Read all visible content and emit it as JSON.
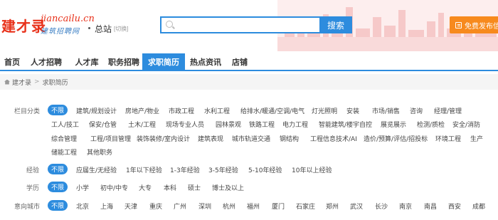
{
  "logo": {
    "main": "建才录",
    "domain": "jiancailu.cn",
    "sub": "建筑招聘网"
  },
  "site": {
    "name": "总站",
    "switch": "[切换]"
  },
  "search": {
    "placeholder": "",
    "button": "搜索"
  },
  "post_button": "免费发布信",
  "nav": [
    "首页",
    "人才招聘",
    "人才库",
    "职务招聘",
    "求职简历",
    "热点资讯",
    "店铺"
  ],
  "breadcrumb": {
    "home": "建才录",
    "current": "求职简历"
  },
  "filters": {
    "category": {
      "label": "栏目分类",
      "items": [
        "不限",
        "建筑/规划设计",
        "房地产/物业",
        "市政工程",
        "水利工程",
        "给排水/暖通/空调/电气",
        "灯光照明",
        "安装",
        "市场/销售",
        "咨询",
        "经理/管理",
        "工人/技工",
        "保安/仓管",
        "土木/工程",
        "现场专业人员",
        "园林景观",
        "铁路工程",
        "电力工程",
        "智能建筑/楼宇自控",
        "展览展示",
        "检测/质检",
        "安全/消防",
        "综合管理",
        "工程/项目管理",
        "装饰装修/室内设计",
        "建筑表现",
        "城市轨道交通",
        "钢结构",
        "工程信息技术/AI",
        "造价/预算/评估/招投标",
        "环境工程",
        "生产",
        "储能工程",
        "其他职务"
      ]
    },
    "experience": {
      "label": "经验",
      "items": [
        "不限",
        "应届生/无经验",
        "1年以下经验",
        "1-3年经验",
        "3-5年经验",
        "5-10年经验",
        "10年以上经验"
      ]
    },
    "education": {
      "label": "学历",
      "items": [
        "不限",
        "小学",
        "初中/中专",
        "大专",
        "本科",
        "硕士",
        "博士及以上"
      ]
    },
    "city": {
      "label": "意向城市",
      "items": [
        "不限",
        "北京",
        "上海",
        "天津",
        "重庆",
        "广州",
        "深圳",
        "杭州",
        "福州",
        "厦门",
        "石家庄",
        "郑州",
        "武汉",
        "长沙",
        "南京",
        "南昌",
        "西安",
        "成都"
      ]
    }
  },
  "colors": {
    "accent": "#2d8cde",
    "brand": "#e8311a",
    "post": "#f78a1d"
  }
}
